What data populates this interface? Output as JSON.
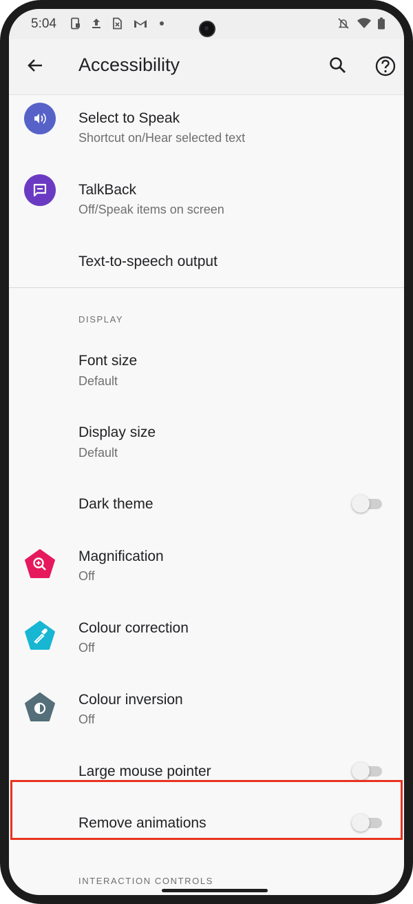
{
  "status_bar": {
    "time": "5:04",
    "icons_left": [
      "device-icon",
      "upload-icon",
      "sim-icon",
      "gmail-icon",
      "dot-icon"
    ],
    "icons_right": [
      "mute-icon",
      "wifi-icon",
      "battery-icon"
    ]
  },
  "app_bar": {
    "title": "Accessibility",
    "actions": [
      "back-icon",
      "search-icon",
      "help-icon"
    ]
  },
  "items": {
    "select_to_speak": {
      "title": "Select to Speak",
      "subtitle": "Shortcut on/Hear selected text",
      "icon_color": "#5762c8"
    },
    "talkback": {
      "title": "TalkBack",
      "subtitle": "Off/Speak items on screen",
      "icon_color": "#6a3bc2"
    },
    "tts_output": {
      "title": "Text-to-speech output"
    },
    "display_header": "DISPLAY",
    "font_size": {
      "title": "Font size",
      "subtitle": "Default"
    },
    "display_size": {
      "title": "Display size",
      "subtitle": "Default"
    },
    "dark_theme": {
      "title": "Dark theme",
      "toggle_on": false
    },
    "magnification": {
      "title": "Magnification",
      "subtitle": "Off",
      "icon_color": "#e6195d"
    },
    "colour_correction": {
      "title": "Colour correction",
      "subtitle": "Off",
      "icon_color": "#17b6d3"
    },
    "colour_inversion": {
      "title": "Colour inversion",
      "subtitle": "Off",
      "icon_color": "#546e7a"
    },
    "large_mouse_pointer": {
      "title": "Large mouse pointer",
      "toggle_on": false
    },
    "remove_animations": {
      "title": "Remove animations",
      "toggle_on": false
    },
    "interaction_header": "INTERACTION CONTROLS"
  },
  "colors": {
    "highlight": "#e8321e",
    "background": "#f8f8f8"
  }
}
